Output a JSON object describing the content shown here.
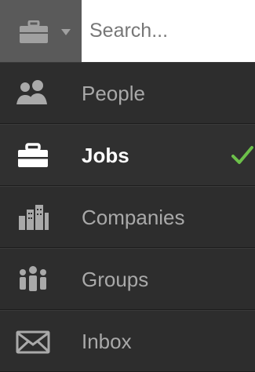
{
  "search": {
    "placeholder": "Search..."
  },
  "items": [
    {
      "label": "People",
      "icon": "people-icon",
      "active": false
    },
    {
      "label": "Jobs",
      "icon": "briefcase-icon",
      "active": true
    },
    {
      "label": "Companies",
      "icon": "buildings-icon",
      "active": false
    },
    {
      "label": "Groups",
      "icon": "group-icon",
      "active": false
    },
    {
      "label": "Inbox",
      "icon": "envelope-icon",
      "active": false
    }
  ],
  "colors": {
    "check": "#6cc04a",
    "active_text": "#ffffff",
    "text": "#a9a9a9"
  }
}
